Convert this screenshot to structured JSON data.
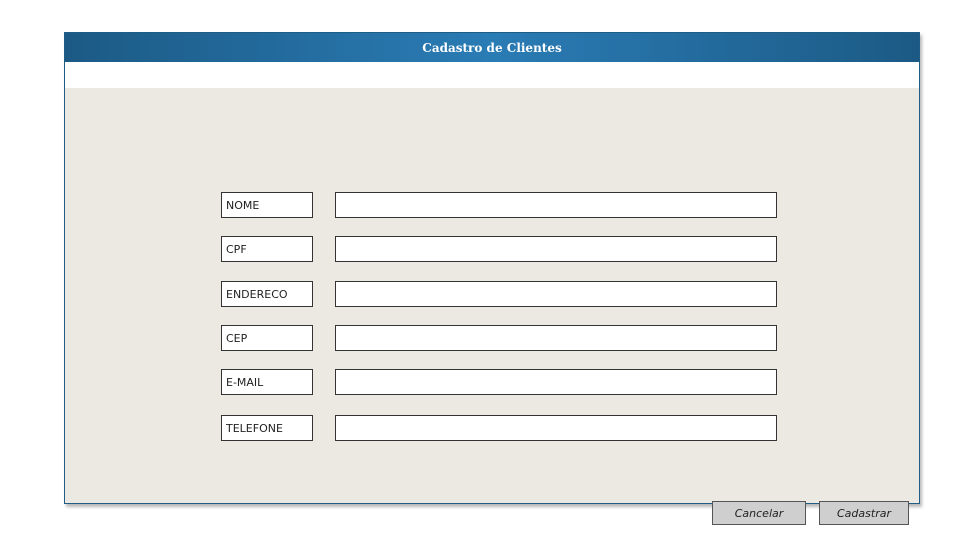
{
  "window": {
    "title": "Cadastro de Clientes"
  },
  "form": {
    "fields": [
      {
        "label": "NOME",
        "value": ""
      },
      {
        "label": "CPF",
        "value": ""
      },
      {
        "label": "ENDERECO",
        "value": ""
      },
      {
        "label": "CEP",
        "value": ""
      },
      {
        "label": "E-MAIL",
        "value": ""
      },
      {
        "label": "TELEFONE",
        "value": ""
      }
    ]
  },
  "actions": {
    "cancel_label": "Cancelar",
    "submit_label": "Cadastrar"
  },
  "colors": {
    "titlebar": "#2a7cb5",
    "content_background": "#ece9e2",
    "button_background": "#cfcfcf"
  }
}
